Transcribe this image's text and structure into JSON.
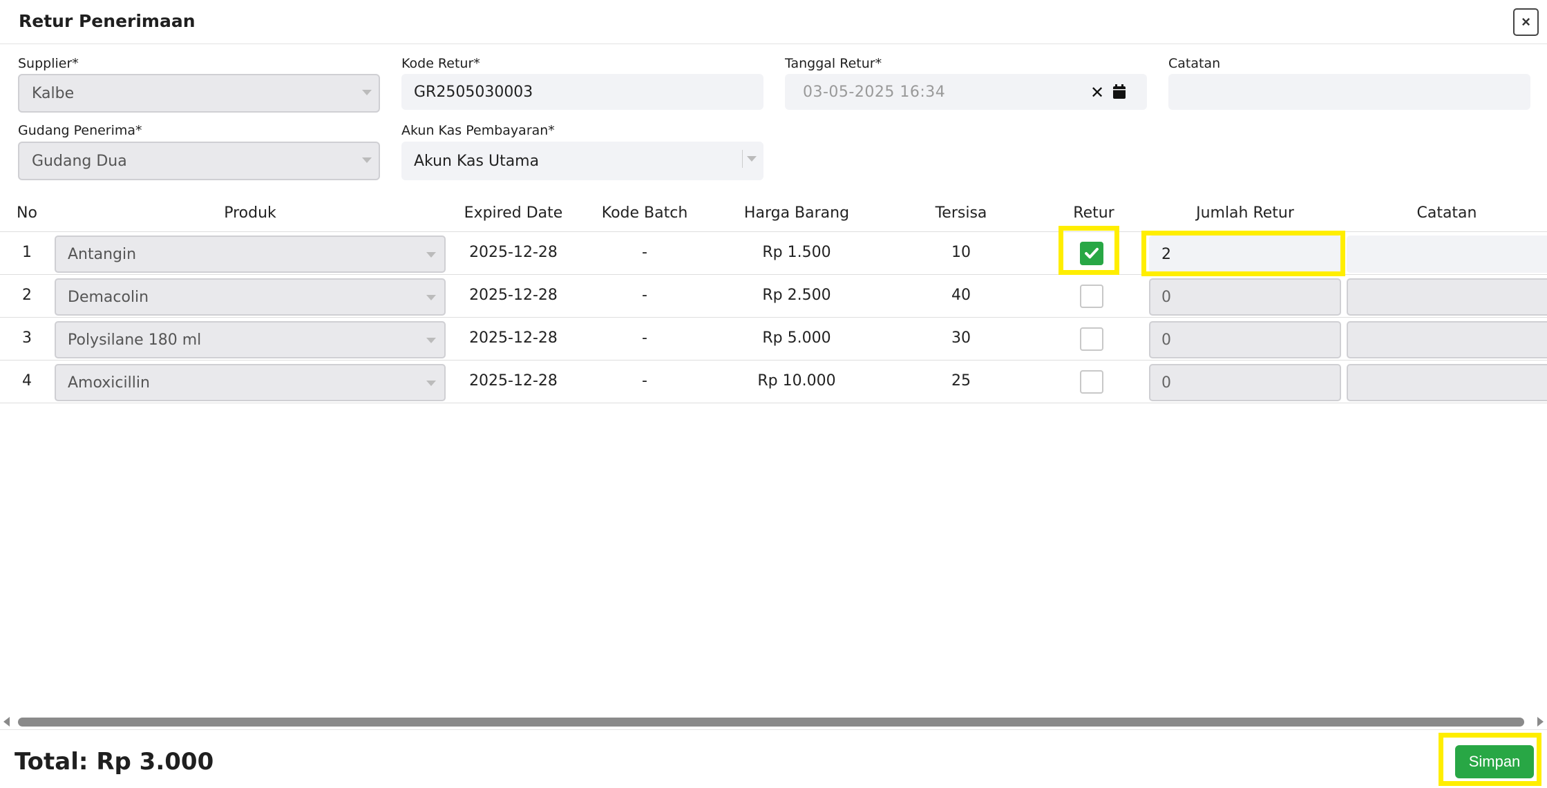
{
  "modal": {
    "title": "Retur Penerimaan",
    "close_label": "×"
  },
  "form": {
    "supplier": {
      "label": "Supplier*",
      "value": "Kalbe"
    },
    "kode_retur": {
      "label": "Kode Retur*",
      "value": "GR2505030003"
    },
    "tanggal_retur": {
      "label": "Tanggal Retur*",
      "value": "03-05-2025 16:34",
      "clear_label": "✕"
    },
    "catatan": {
      "label": "Catatan",
      "value": ""
    },
    "gudang_penerima": {
      "label": "Gudang Penerima*",
      "value": "Gudang Dua"
    },
    "akun_kas": {
      "label": "Akun Kas Pembayaran*",
      "value": "Akun Kas Utama"
    }
  },
  "table": {
    "headers": [
      "No",
      "Produk",
      "Expired Date",
      "Kode Batch",
      "Harga Barang",
      "Tersisa",
      "Retur",
      "Jumlah Retur",
      "Catatan"
    ],
    "rows": [
      {
        "no": "1",
        "produk": "Antangin",
        "expired": "2025-12-28",
        "batch": "-",
        "harga": "Rp 1.500",
        "tersisa": "10",
        "retur": true,
        "jumlah": "2"
      },
      {
        "no": "2",
        "produk": "Demacolin",
        "expired": "2025-12-28",
        "batch": "-",
        "harga": "Rp 2.500",
        "tersisa": "40",
        "retur": false,
        "jumlah": "0"
      },
      {
        "no": "3",
        "produk": "Polysilane 180 ml",
        "expired": "2025-12-28",
        "batch": "-",
        "harga": "Rp 5.000",
        "tersisa": "30",
        "retur": false,
        "jumlah": "0"
      },
      {
        "no": "4",
        "produk": "Amoxicillin",
        "expired": "2025-12-28",
        "batch": "-",
        "harga": "Rp 10.000",
        "tersisa": "25",
        "retur": false,
        "jumlah": "0"
      }
    ]
  },
  "footer": {
    "total": "Total: Rp 3.000",
    "save_label": "Simpan"
  },
  "colors": {
    "accent": "#28a745",
    "highlight": "#ffee00"
  },
  "icons": {
    "close": "close-icon",
    "date_clear": "clear-icon",
    "calendar": "calendar-icon",
    "dropdown": "chevron-down-icon",
    "check": "check-icon"
  }
}
